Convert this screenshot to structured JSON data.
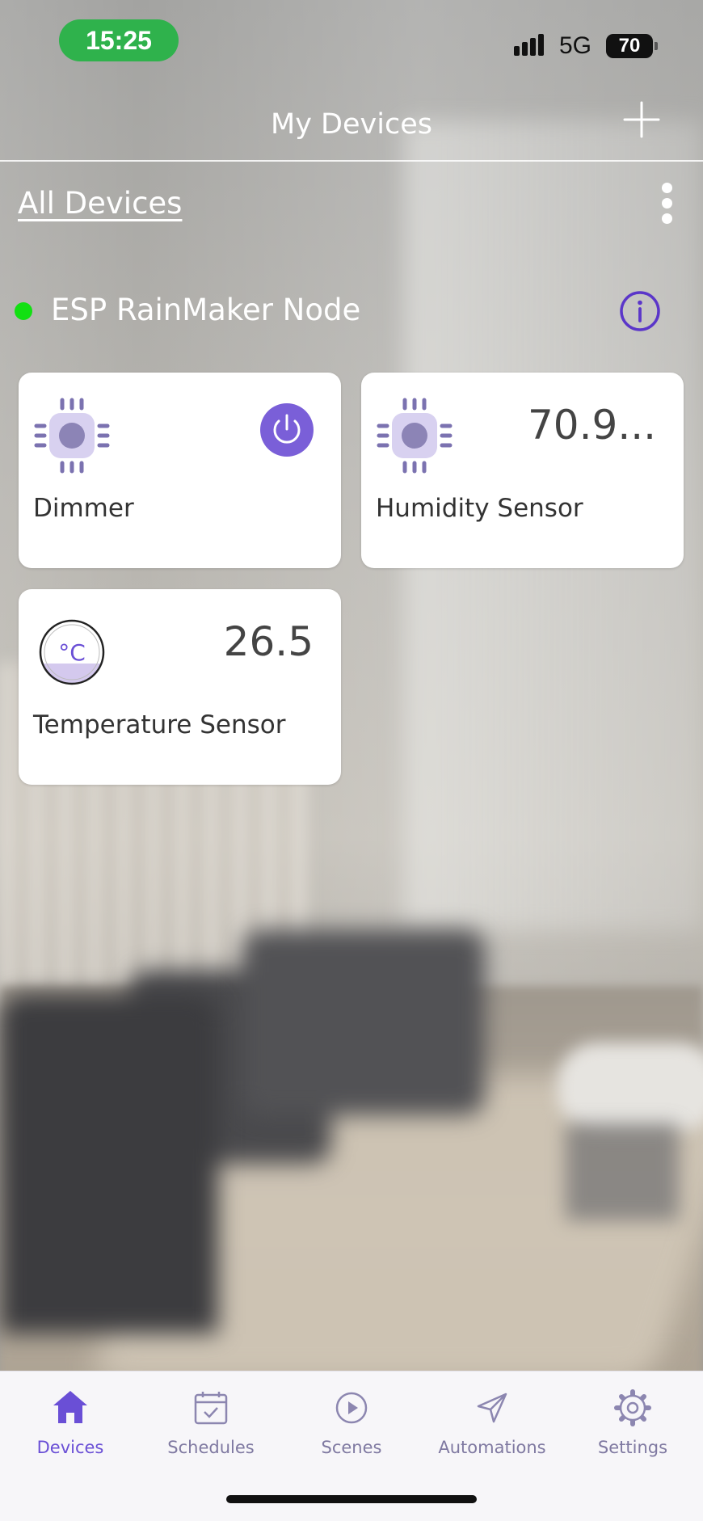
{
  "status_bar": {
    "time": "15:25",
    "network": "5G",
    "battery": "70"
  },
  "header": {
    "title": "My Devices"
  },
  "filter": {
    "label": "All Devices"
  },
  "node": {
    "name": "ESP RainMaker Node",
    "online": true
  },
  "devices": [
    {
      "name": "Dimmer",
      "value": "",
      "icon": "chip-icon",
      "has_power": true
    },
    {
      "name": "Humidity Sensor",
      "value": "70.9...",
      "icon": "chip-icon",
      "has_power": false
    },
    {
      "name": "Temperature Sensor",
      "value": "26.5",
      "icon": "thermometer-celsius-icon",
      "has_power": false
    }
  ],
  "tabs": [
    {
      "label": "Devices",
      "icon": "home-icon",
      "active": true
    },
    {
      "label": "Schedules",
      "icon": "calendar-icon",
      "active": false
    },
    {
      "label": "Scenes",
      "icon": "play-icon",
      "active": false
    },
    {
      "label": "Automations",
      "icon": "send-icon",
      "active": false
    },
    {
      "label": "Settings",
      "icon": "gear-icon",
      "active": false
    }
  ],
  "colors": {
    "accent": "#6a4fd6",
    "power_button": "#7a5fd8",
    "chip_fill": "#d8d1f0",
    "chip_pins": "#7b72b0",
    "online_dot": "#12e012",
    "time_pill": "#2fb24c"
  }
}
